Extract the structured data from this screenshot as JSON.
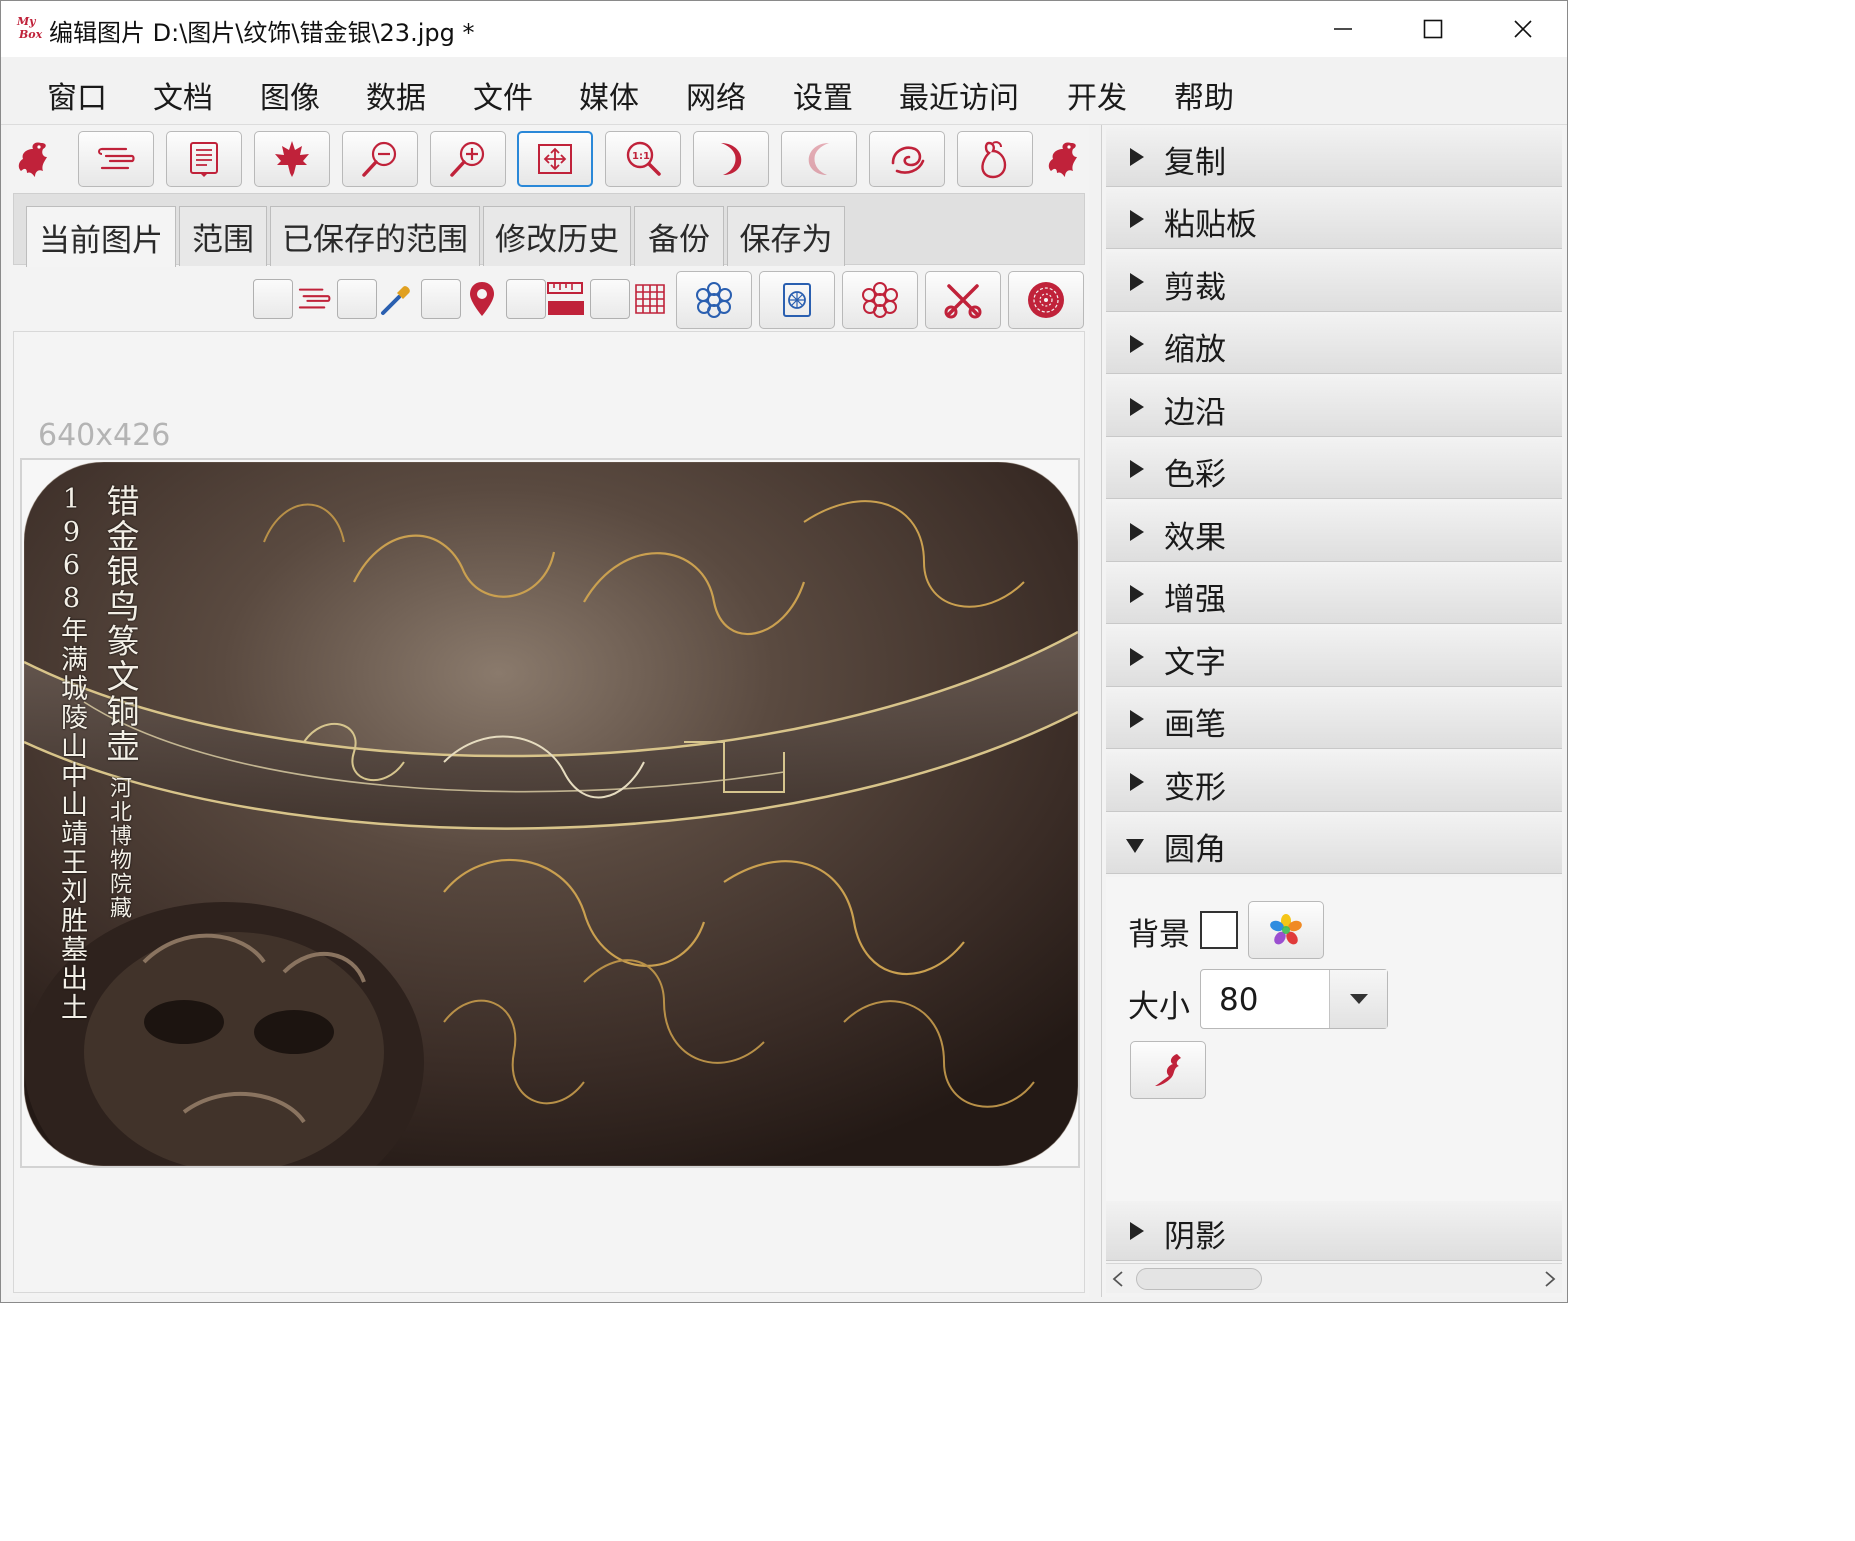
{
  "window": {
    "logo_top": "My",
    "logo_bottom": "Box",
    "title": "编辑图片 D:\\图片\\纹饰\\错金银\\23.jpg  *"
  },
  "menu": [
    "窗口",
    "文档",
    "图像",
    "数据",
    "文件",
    "媒体",
    "网络",
    "设置",
    "最近访问",
    "开发",
    "帮助"
  ],
  "toolbar": {
    "buttons": [
      {
        "icon": "paragraph-lines-icon"
      },
      {
        "icon": "notes-icon"
      },
      {
        "icon": "maple-leaf-icon"
      },
      {
        "icon": "zoom-out-icon"
      },
      {
        "icon": "zoom-in-icon"
      },
      {
        "icon": "fit-screen-icon",
        "active": true
      },
      {
        "icon": "actual-size-icon"
      },
      {
        "icon": "rotate-right-icon"
      },
      {
        "icon": "rotate-left-icon",
        "disabled": true
      },
      {
        "icon": "swirl-icon"
      },
      {
        "icon": "gourd-icon"
      }
    ]
  },
  "tabs": [
    "当前图片",
    "范围",
    "已保存的范围",
    "修改历史",
    "备份",
    "保存为"
  ],
  "selected_tab": 0,
  "image": {
    "dimensions": "640x426",
    "caption_main": "错金银鸟篆文铜壶",
    "caption_museum": "河北博物院藏",
    "caption_origin": "1968年满城陵山中山靖王刘胜墓出土"
  },
  "right_panel": {
    "sections": [
      "复制",
      "粘贴板",
      "剪裁",
      "缩放",
      "边沿",
      "色彩",
      "效果",
      "增强",
      "文字",
      "画笔",
      "变形",
      "圆角"
    ],
    "expanded": "圆角",
    "last_section": "阴影",
    "rounded_corner": {
      "background_label": "背景",
      "size_label": "大小",
      "size_value": "80"
    }
  },
  "colors": {
    "accent": "#c0223a",
    "blue": "#2a5fb0",
    "active_border": "#2a88d8"
  }
}
